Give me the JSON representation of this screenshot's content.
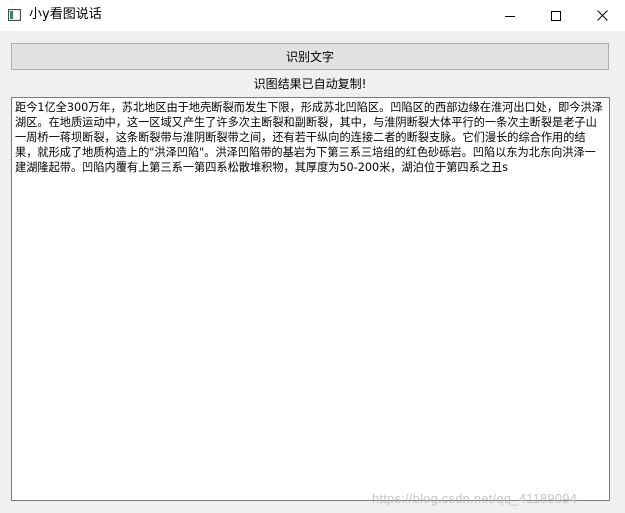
{
  "window": {
    "title": "小y看图说话"
  },
  "toolbar": {
    "recognize_label": "识别文字"
  },
  "status": {
    "message": "识图结果已自动复制!"
  },
  "result": {
    "text": "距今1亿全300万年，苏北地区由于地壳断裂而发生下限，形成苏北凹陷区。凹陷区的西部边缘在淮河出口处，即今洪泽湖区。在地质运动中，这一区域又产生了许多次主断裂和副断裂，其中，与淮阴断裂大体平行的一条次主断裂是老子山一周桥一蒋坝断裂，这条断裂带与淮阴断裂带之间，还有若干纵向的连接二者的断裂支脉。它们漫长的综合作用的结果，就形成了地质构造上的\"洪泽凹陷\"。洪泽凹陷带的基岩为下第三系三培组的红色砂砾岩。凹陷以东为北东向洪泽一建湖隆起带。凹陷内覆有上第三系一第四系松散堆积物，其厚度为50-200米，湖泊位于第四系之丑s"
  },
  "watermark": {
    "text": "https://blog.csdn.net/qq_41189094"
  },
  "icons": {
    "minimize": "minimize-icon",
    "maximize": "maximize-icon",
    "close": "close-icon",
    "app": "app-window-icon"
  }
}
